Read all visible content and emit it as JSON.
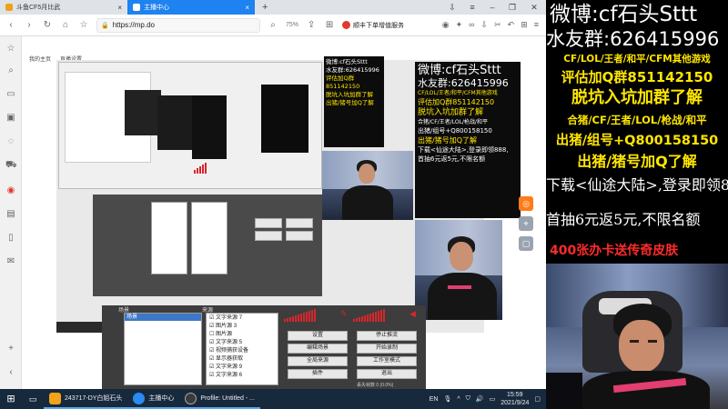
{
  "browser": {
    "tabs": [
      {
        "label": "斗鱼CF5月比武",
        "active": false
      },
      {
        "label": "主播中心",
        "active": true
      }
    ],
    "new_tab": "+",
    "url": "https://mp.do",
    "zoom": "75%",
    "ad_text": "顺丰下单增值服务"
  },
  "page": {
    "breadcrumb": [
      "我的主页",
      "直播设置"
    ],
    "side_buttons": [
      "◎",
      "⌖",
      "▢"
    ]
  },
  "preview": {
    "weibo": "微博:cf石头Sttt",
    "qq_group": "水友群:626415996",
    "games": "CF/LOL/王者/和平/CFM其他游戏",
    "eval": "评估加Q群851142150",
    "join": "脱坑入坑加群了解",
    "merge": "合猪/CF/王者/LOL/枪战/和平",
    "exit_group": "出猪/组号+Q800158150",
    "exit_pig": "出猪/猪号加Q了解",
    "download": "下载<仙途大陆>,登录即领888,",
    "first": "首抽6元返5元,不限名额",
    "obs_scenes": "场景",
    "obs_sources": "来源",
    "scene_item": "场景",
    "sources": [
      "文字来源 7",
      "图片源 3",
      "图片源",
      "文字来源 5",
      "视频捕获设备",
      "显示器获取",
      "文字来源 9",
      "文字来源 6"
    ],
    "obs_buttons": [
      "设置",
      "停止推流",
      "编辑场景",
      "开始录制",
      "全局来源",
      "工作室模式",
      "插件",
      "退出"
    ],
    "status": "丢失帧数 0 (0.0%)"
  },
  "overlay": {
    "weibo": "微博:cf石头Sttt",
    "qq_group": "水友群:626415996",
    "games": "CF/LOL/王者/和平/CFM其他游戏",
    "eval": "评估加Q群851142150",
    "join": "脱坑入坑加群了解",
    "merge": "合猪/CF/王者/LOL/枪战/和平",
    "exit_group": "出猪/组号+Q800158150",
    "exit_pig": "出猪/猪号加Q了解",
    "download": "下载<仙途大陆>,登录即领888,",
    "first": "首抽6元返5元,不限名额",
    "cards": "400张办卡送传奇皮肤"
  },
  "taskbar": {
    "items": [
      {
        "label": "243717-DY白姐石头"
      },
      {
        "label": "主播中心"
      },
      {
        "label": "Profile: Untitled - ..."
      }
    ],
    "ime": "EN",
    "time": "15:59",
    "date": "2021/9/24"
  },
  "colors": {
    "tab_active": "#1e82f0",
    "taskbar": "#17293d",
    "overlay_bg": "#000000",
    "yellow": "#ffe600",
    "red": "#ff2a2a",
    "white": "#ffffff"
  }
}
